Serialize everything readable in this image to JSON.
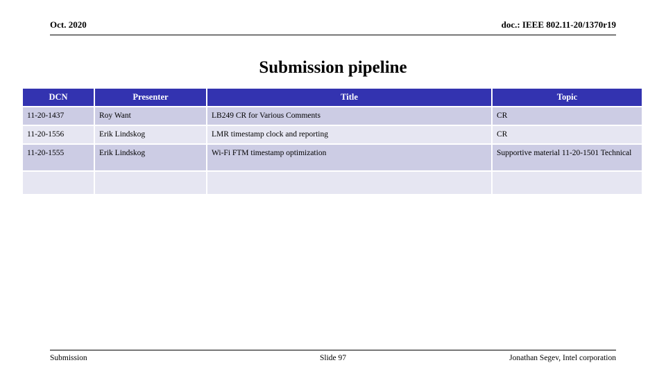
{
  "header": {
    "date": "Oct. 2020",
    "doc": "doc.: IEEE 802.11-20/1370r19"
  },
  "title": "Submission pipeline",
  "table": {
    "columns": [
      "DCN",
      "Presenter",
      "Title",
      "Topic"
    ],
    "rows": [
      {
        "dcn": "11-20-1437",
        "presenter": "Roy Want",
        "title": "LB249 CR for Various Comments",
        "topic": "CR"
      },
      {
        "dcn": "11-20-1556",
        "presenter": "Erik Lindskog",
        "title": "LMR timestamp clock and reporting",
        "topic": "CR"
      },
      {
        "dcn": "11-20-1555",
        "presenter": "Erik Lindskog",
        "title": "Wi-Fi FTM timestamp optimization",
        "topic": "Supportive material 11-20-1501 Technical"
      },
      {
        "dcn": "",
        "presenter": "",
        "title": "",
        "topic": ""
      }
    ]
  },
  "footer": {
    "left": "Submission",
    "center": "Slide 97",
    "right": "Jonathan Segev, Intel corporation"
  },
  "colors": {
    "header_fill": "#3333B0",
    "header_text": "#FFFFFF",
    "row_shade_a": "#CCCCE4",
    "row_shade_b": "#E6E6F2",
    "rule": "#000000"
  }
}
